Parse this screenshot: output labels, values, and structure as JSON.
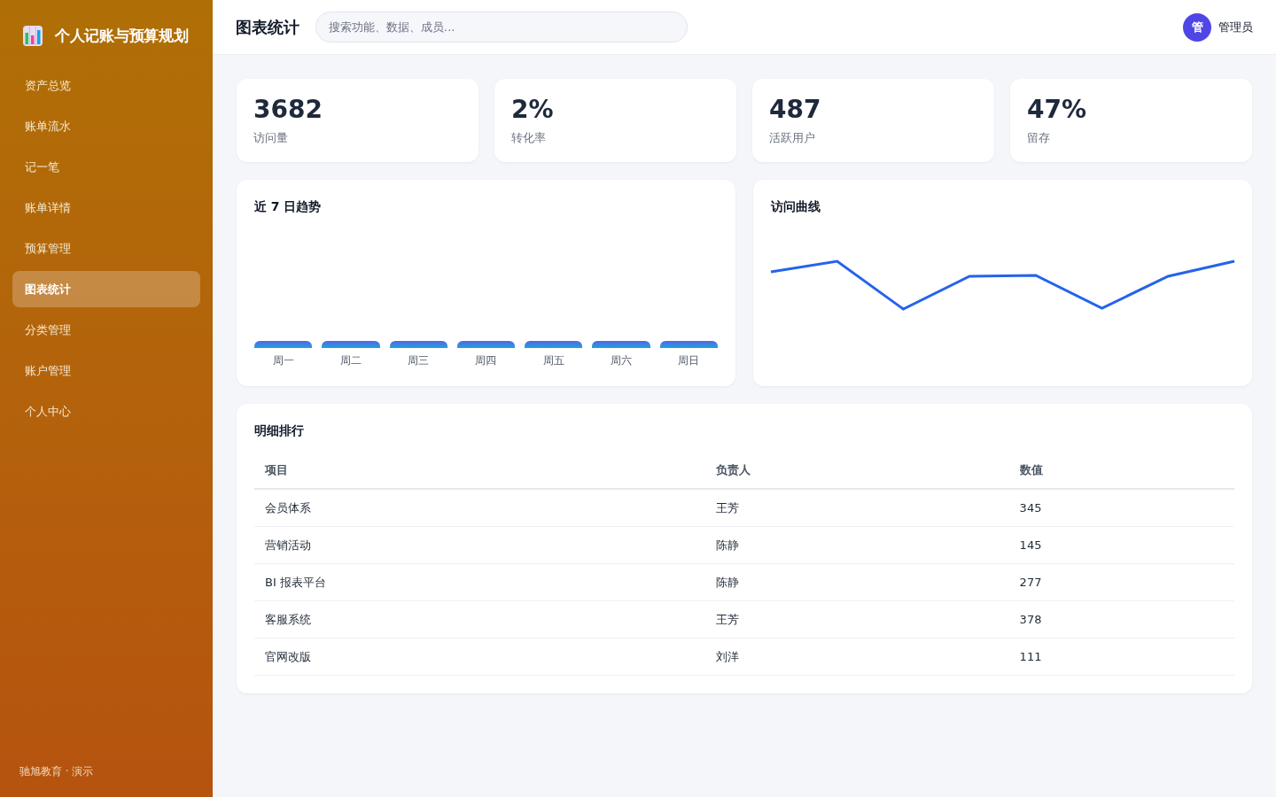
{
  "sidebar": {
    "brand": "个人记账与预算规划",
    "items": [
      {
        "label": "资产总览",
        "selected": false
      },
      {
        "label": "账单流水",
        "selected": false
      },
      {
        "label": "记一笔",
        "selected": false
      },
      {
        "label": "账单详情",
        "selected": false
      },
      {
        "label": "预算管理",
        "selected": false
      },
      {
        "label": "图表统计",
        "selected": true
      },
      {
        "label": "分类管理",
        "selected": false
      },
      {
        "label": "账户管理",
        "selected": false
      },
      {
        "label": "个人中心",
        "selected": false
      }
    ],
    "footer": "驰旭教育 · 演示"
  },
  "header": {
    "title": "图表统计",
    "search": {
      "placeholder": "搜索功能、数据、成员..."
    },
    "user": {
      "avatar": "管",
      "name": "管理员"
    }
  },
  "stats": [
    {
      "value": "3682",
      "label": "访问量"
    },
    {
      "value": "2%",
      "label": "转化率"
    },
    {
      "value": "487",
      "label": "活跃用户"
    },
    {
      "value": "47%",
      "label": "留存"
    }
  ],
  "trend_card": {
    "title": "近 7 日趋势",
    "bars": [
      {
        "label": "周一"
      },
      {
        "label": "周二"
      },
      {
        "label": "周三"
      },
      {
        "label": "周四"
      },
      {
        "label": "周五"
      },
      {
        "label": "周六"
      },
      {
        "label": "周日"
      }
    ]
  },
  "line_card": {
    "title": "访问曲线"
  },
  "ranking": {
    "title": "明细排行",
    "columns": [
      "项目",
      "负责人",
      "数值"
    ],
    "rows": [
      [
        "会员体系",
        "王芳",
        "345"
      ],
      [
        "营销活动",
        "陈静",
        "145"
      ],
      [
        "BI 报表平台",
        "陈静",
        "277"
      ],
      [
        "客服系统",
        "王芳",
        "378"
      ],
      [
        "官网改版",
        "刘洋",
        "111"
      ]
    ]
  }
}
